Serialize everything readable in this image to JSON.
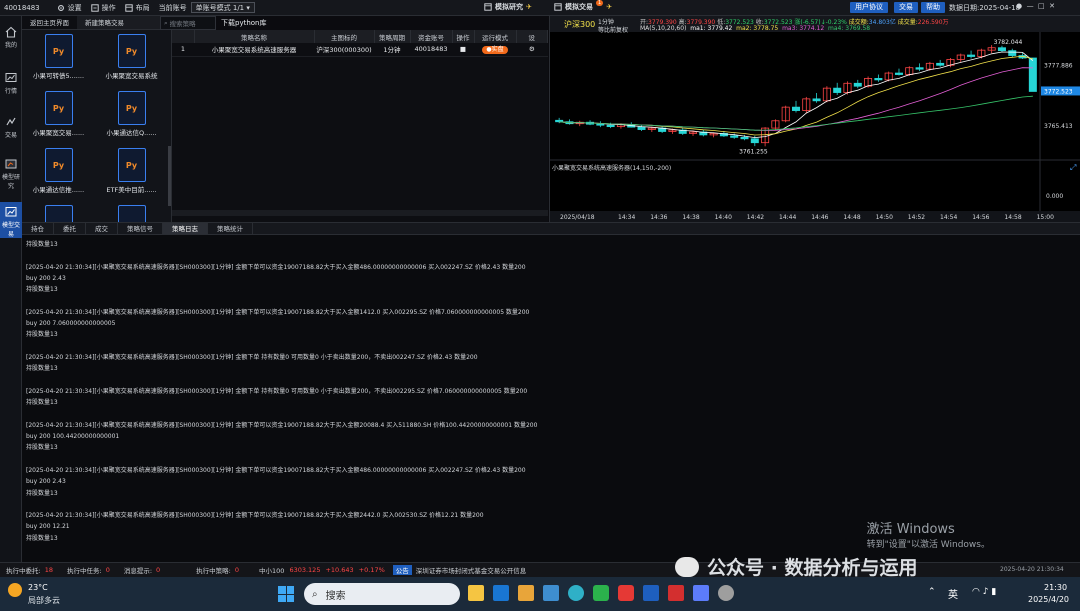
{
  "topbar": {
    "account_id": "40018483",
    "settings": "设置",
    "operate": "操作",
    "layout": "布局",
    "current_account": "当前账号",
    "account_mode": "单账号模式 1/1",
    "sim_research": "模拟研究",
    "sim_trade": "模拟交易",
    "sim_trade_badge": "1",
    "user_agreement": "用户协议",
    "trade": "交易",
    "help": "帮助",
    "data_date": "数据日期:2025-04-18"
  },
  "leftnav": [
    {
      "label": "我的",
      "icon": "home-icon"
    },
    {
      "label": "行情",
      "icon": "chart-icon"
    },
    {
      "label": "交易",
      "icon": "trade-icon"
    },
    {
      "label": "模型研究",
      "icon": "model-icon"
    },
    {
      "label": "模型交易",
      "icon": "model-trade-icon",
      "active": true
    }
  ],
  "strategy_panel": {
    "tabs": [
      "返回主页界面",
      "新建策略交易"
    ],
    "search_placeholder": "搜索策略",
    "files": [
      "小果可转债5.......",
      "小果聚宽交易系统",
      "小果聚宽交易......",
      "小果通达信Q......",
      "小果通达信推......",
      "ETF美中目前......",
      "",
      ""
    ],
    "py_text": "Py",
    "library_title": "下载python库"
  },
  "strategy_table": {
    "headers": [
      "",
      "策略名称",
      "主图标的",
      "策略周期",
      "资金账号",
      "操作",
      "运行模式",
      "设"
    ],
    "rows": [
      {
        "index": "1",
        "name": "小果聚宽交易系统高速服务器",
        "target": "沪深300(000300)",
        "period": "1分钟",
        "account": "40018483",
        "op": "■",
        "mode": "实盘",
        "set": "⚙"
      }
    ]
  },
  "chart": {
    "index_name": "沪深300",
    "period": "1分钟",
    "adjust": "等比前复权",
    "open_label": "开:",
    "open": "3779.390",
    "high_label": "高:",
    "high": "3779.390",
    "low_label": "低:",
    "low": "3772.523",
    "close_label": "收:",
    "close": "3772.523",
    "change": "涨(-6.57)↓-0.23%",
    "amount_label": "成交额:",
    "amount": "34.803亿",
    "volume_label": "成交量:",
    "volume": "226.590万",
    "ma_label": "MA(5,10,20,60)",
    "ma1": "ma1: 3779.42",
    "ma2": "ma2: 3778.75",
    "ma3": "ma3: 3774.12",
    "ma4": "ma4: 3769.58",
    "high_marker": "3782.044",
    "low_marker": "3761.255",
    "price_axis": [
      "3777.886",
      "3772.523",
      "3765.413"
    ],
    "indicator_label": "小果聚宽交易系统高速服务器(14,150,-200)",
    "indicator_value": "0.000",
    "time_axis": [
      "2025/04/18",
      "14:34",
      "14:36",
      "14:38",
      "14:40",
      "14:42",
      "14:44",
      "14:46",
      "14:48",
      "14:50",
      "14:52",
      "14:54",
      "14:56",
      "14:58",
      "15:00"
    ],
    "candles": [
      {
        "o": 3766.6,
        "h": 3767.1,
        "l": 3766.0,
        "c": 3766.3
      },
      {
        "o": 3766.3,
        "h": 3766.8,
        "l": 3765.7,
        "c": 3765.9
      },
      {
        "o": 3765.9,
        "h": 3766.5,
        "l": 3765.4,
        "c": 3766.2
      },
      {
        "o": 3766.2,
        "h": 3766.6,
        "l": 3765.6,
        "c": 3765.8
      },
      {
        "o": 3765.8,
        "h": 3766.4,
        "l": 3765.2,
        "c": 3765.6
      },
      {
        "o": 3765.6,
        "h": 3766.1,
        "l": 3765.0,
        "c": 3765.3
      },
      {
        "o": 3765.3,
        "h": 3766.0,
        "l": 3764.9,
        "c": 3765.7
      },
      {
        "o": 3765.7,
        "h": 3766.2,
        "l": 3765.1,
        "c": 3765.2
      },
      {
        "o": 3765.2,
        "h": 3765.6,
        "l": 3764.4,
        "c": 3764.7
      },
      {
        "o": 3764.7,
        "h": 3765.3,
        "l": 3764.2,
        "c": 3765.0
      },
      {
        "o": 3765.0,
        "h": 3765.4,
        "l": 3764.0,
        "c": 3764.3
      },
      {
        "o": 3764.3,
        "h": 3764.9,
        "l": 3763.8,
        "c": 3764.6
      },
      {
        "o": 3764.6,
        "h": 3765.0,
        "l": 3763.6,
        "c": 3763.9
      },
      {
        "o": 3763.9,
        "h": 3764.5,
        "l": 3763.4,
        "c": 3764.2
      },
      {
        "o": 3764.2,
        "h": 3764.7,
        "l": 3763.3,
        "c": 3763.6
      },
      {
        "o": 3763.6,
        "h": 3764.1,
        "l": 3763.1,
        "c": 3763.9
      },
      {
        "o": 3763.9,
        "h": 3764.4,
        "l": 3763.2,
        "c": 3763.4
      },
      {
        "o": 3763.4,
        "h": 3763.9,
        "l": 3762.8,
        "c": 3763.1
      },
      {
        "o": 3763.1,
        "h": 3763.6,
        "l": 3762.5,
        "c": 3762.8
      },
      {
        "o": 3762.8,
        "h": 3763.4,
        "l": 3761.3,
        "c": 3762.0
      },
      {
        "o": 3762.0,
        "h": 3765.2,
        "l": 3761.255,
        "c": 3765.0
      },
      {
        "o": 3765.0,
        "h": 3766.8,
        "l": 3764.6,
        "c": 3766.5
      },
      {
        "o": 3766.5,
        "h": 3769.6,
        "l": 3766.2,
        "c": 3769.3
      },
      {
        "o": 3769.3,
        "h": 3770.6,
        "l": 3768.2,
        "c": 3768.6
      },
      {
        "o": 3768.6,
        "h": 3771.4,
        "l": 3768.1,
        "c": 3771.0
      },
      {
        "o": 3771.0,
        "h": 3772.2,
        "l": 3770.2,
        "c": 3770.6
      },
      {
        "o": 3770.6,
        "h": 3773.6,
        "l": 3770.3,
        "c": 3773.2
      },
      {
        "o": 3773.2,
        "h": 3774.3,
        "l": 3771.8,
        "c": 3772.3
      },
      {
        "o": 3772.3,
        "h": 3774.6,
        "l": 3771.9,
        "c": 3774.2
      },
      {
        "o": 3774.2,
        "h": 3774.9,
        "l": 3773.2,
        "c": 3773.6
      },
      {
        "o": 3773.6,
        "h": 3775.6,
        "l": 3773.3,
        "c": 3775.2
      },
      {
        "o": 3775.2,
        "h": 3776.0,
        "l": 3774.5,
        "c": 3774.9
      },
      {
        "o": 3774.9,
        "h": 3776.6,
        "l": 3774.6,
        "c": 3776.3
      },
      {
        "o": 3776.3,
        "h": 3777.2,
        "l": 3775.8,
        "c": 3776.0
      },
      {
        "o": 3776.0,
        "h": 3777.7,
        "l": 3775.7,
        "c": 3777.4
      },
      {
        "o": 3777.4,
        "h": 3778.3,
        "l": 3776.7,
        "c": 3777.1
      },
      {
        "o": 3777.1,
        "h": 3778.6,
        "l": 3776.8,
        "c": 3778.3
      },
      {
        "o": 3778.3,
        "h": 3779.0,
        "l": 3777.6,
        "c": 3777.9
      },
      {
        "o": 3777.9,
        "h": 3779.4,
        "l": 3777.5,
        "c": 3779.1
      },
      {
        "o": 3779.1,
        "h": 3780.3,
        "l": 3778.5,
        "c": 3780.0
      },
      {
        "o": 3780.0,
        "h": 3780.9,
        "l": 3779.3,
        "c": 3779.7
      },
      {
        "o": 3779.7,
        "h": 3781.3,
        "l": 3779.3,
        "c": 3781.0
      },
      {
        "o": 3781.0,
        "h": 3782.044,
        "l": 3780.4,
        "c": 3781.5
      },
      {
        "o": 3781.5,
        "h": 3781.9,
        "l": 3780.6,
        "c": 3780.9
      },
      {
        "o": 3780.9,
        "h": 3781.3,
        "l": 3779.6,
        "c": 3779.9
      },
      {
        "o": 3779.9,
        "h": 3780.4,
        "l": 3779.2,
        "c": 3779.39
      },
      {
        "o": 3779.39,
        "h": 3779.39,
        "l": 3772.523,
        "c": 3772.523
      }
    ]
  },
  "bottom_tabs": [
    "持仓",
    "委托",
    "成交",
    "策略信号",
    "策略日志",
    "策略统计"
  ],
  "log_lines": [
    "持股数量13",
    "",
    "[2025-04-20 21:30:34][小果聚宽交易系统高速服务器][SH000300][1分钟] 金额下单可以资金19007188.82大于买入金额486.00000000000006 买入002247.SZ 价格2.43 数量200",
    "buy 200 2.43",
    "持股数量13",
    "",
    "[2025-04-20 21:30:34][小果聚宽交易系统高速服务器][SH000300][1分钟] 金额下单可以资金19007188.82大于买入金额1412.0 买入002295.SZ 价格7.060000000000005 数量200",
    "buy 200 7.060000000000005",
    "持股数量13",
    "",
    "[2025-04-20 21:30:34][小果聚宽交易系统高速服务器][SH000300][1分钟] 金额下单 持有数量0 可用数量0 小于卖出数量200，不卖出002247.SZ 价格2.43 数量200",
    "持股数量13",
    "",
    "[2025-04-20 21:30:34][小果聚宽交易系统高速服务器][SH000300][1分钟] 金额下单 持有数量0 可用数量0 小于卖出数量200，不卖出002295.SZ 价格7.060000000000005 数量200",
    "持股数量13",
    "",
    "[2025-04-20 21:30:34][小果聚宽交易系统高速服务器][SH000300][1分钟] 金额下单可以资金19007188.82大于买入金额20088.4 买入511880.SH 价格100.44200000000001 数量200",
    "buy 200 100.44200000000001",
    "持股数量13",
    "",
    "[2025-04-20 21:30:34][小果聚宽交易系统高速服务器][SH000300][1分钟] 金额下单可以资金19007188.82大于买入金额486.00000000000006 买入002247.SZ 价格2.43 数量200",
    "buy 200 2.43",
    "持股数量13",
    "",
    "[2025-04-20 21:30:34][小果聚宽交易系统高速服务器][SH000300][1分钟] 金额下单可以资金19007188.82大于买入金额2442.0 买入002530.SZ 价格12.21 数量200",
    "buy 200 12.21",
    "持股数量13"
  ],
  "statusbar": {
    "exec_delegate": "执行中委托:",
    "exec_delegate_n": "18",
    "exec_task": "执行中任务:",
    "exec_task_n": "0",
    "msg_tip": "消息提示:",
    "msg_tip_n": "0",
    "exec_strategy": "执行中策略:",
    "exec_strategy_n": "0",
    "index_name": "中小100",
    "index_val": "6303.125",
    "index_chg": "+10.643",
    "index_pct": "+0.17%",
    "notice_tag": "公告",
    "notice": "深圳证券市场封闭式基金交易公开信息",
    "clock": "2025-04-20 21:30:34"
  },
  "watermarks": {
    "win_line1": "激活 Windows",
    "win_line2": "转到\"设置\"以激活 Windows。",
    "wechat": "公众号 · 数据分析与运用"
  },
  "taskbar": {
    "weather_temp": "23°C",
    "weather_desc": "局部多云",
    "search": "搜索",
    "ime": "英",
    "time": "21:30",
    "date": "2025/4/20"
  },
  "colors": {
    "up": "#ff4646",
    "down": "#27d6d6",
    "accent_blue": "#1f5fbf",
    "ma1": "#ffffff",
    "ma2": "#f3e24b",
    "ma3": "#e45fd6",
    "ma4": "#36c46a"
  }
}
